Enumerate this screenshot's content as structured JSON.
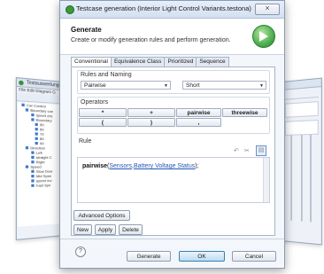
{
  "dialog": {
    "title": "Testcase generation (Interior Light Control Variants.testona)",
    "close_label": "⨯"
  },
  "header": {
    "title": "Generate",
    "description": "Create or modify generation rules and perform generation."
  },
  "tabs": [
    {
      "label": "Conventional",
      "active": true
    },
    {
      "label": "Equivalence Class",
      "active": false
    },
    {
      "label": "Prioritized",
      "active": false
    },
    {
      "label": "Sequence",
      "active": false
    }
  ],
  "rules_naming": {
    "label": "Rules and Naming",
    "rule_type": "Pairwise",
    "naming": "Short"
  },
  "operators": {
    "label": "Operators",
    "row1": [
      "*",
      "+",
      "pairwise",
      "threewise"
    ],
    "row2": [
      "(",
      ")",
      ","
    ]
  },
  "rule": {
    "label": "Rule",
    "function": "pairwise",
    "open": "(",
    "arg1": "Sensors",
    "sep": ",",
    "arg2": "Battery Voltage Status",
    "close": ");"
  },
  "buttons": {
    "advanced": "Advanced Options",
    "new": "New",
    "apply": "Apply",
    "delete": "Delete",
    "generate": "Generate",
    "ok": "OK",
    "cancel": "Cancel",
    "help": "?"
  },
  "background": {
    "left_title": "Testauswertungen Ca",
    "left_menu": "File Edit Diagram G",
    "tree": [
      {
        "text": "Car Control",
        "level": 0
      },
      {
        "text": "Boundary con",
        "level": 1
      },
      {
        "text": "speed (m)",
        "level": 2
      },
      {
        "text": "Boundary",
        "level": 2
      },
      {
        "text": "50",
        "level": 3
      },
      {
        "text": "60",
        "level": 3
      },
      {
        "text": "70",
        "level": 3
      },
      {
        "text": "80",
        "level": 3
      },
      {
        "text": "90",
        "level": 3
      },
      {
        "text": "Direction",
        "level": 1
      },
      {
        "text": "Left",
        "level": 2
      },
      {
        "text": "straight C",
        "level": 2
      },
      {
        "text": "Right",
        "level": 2
      },
      {
        "text": "Speed",
        "level": 1
      },
      {
        "text": "Slow Dow",
        "level": 2
      },
      {
        "text": "Mid Spee",
        "level": 2
      },
      {
        "text": "speed inc",
        "level": 2
      },
      {
        "text": "Fast Spe",
        "level": 2
      }
    ]
  }
}
